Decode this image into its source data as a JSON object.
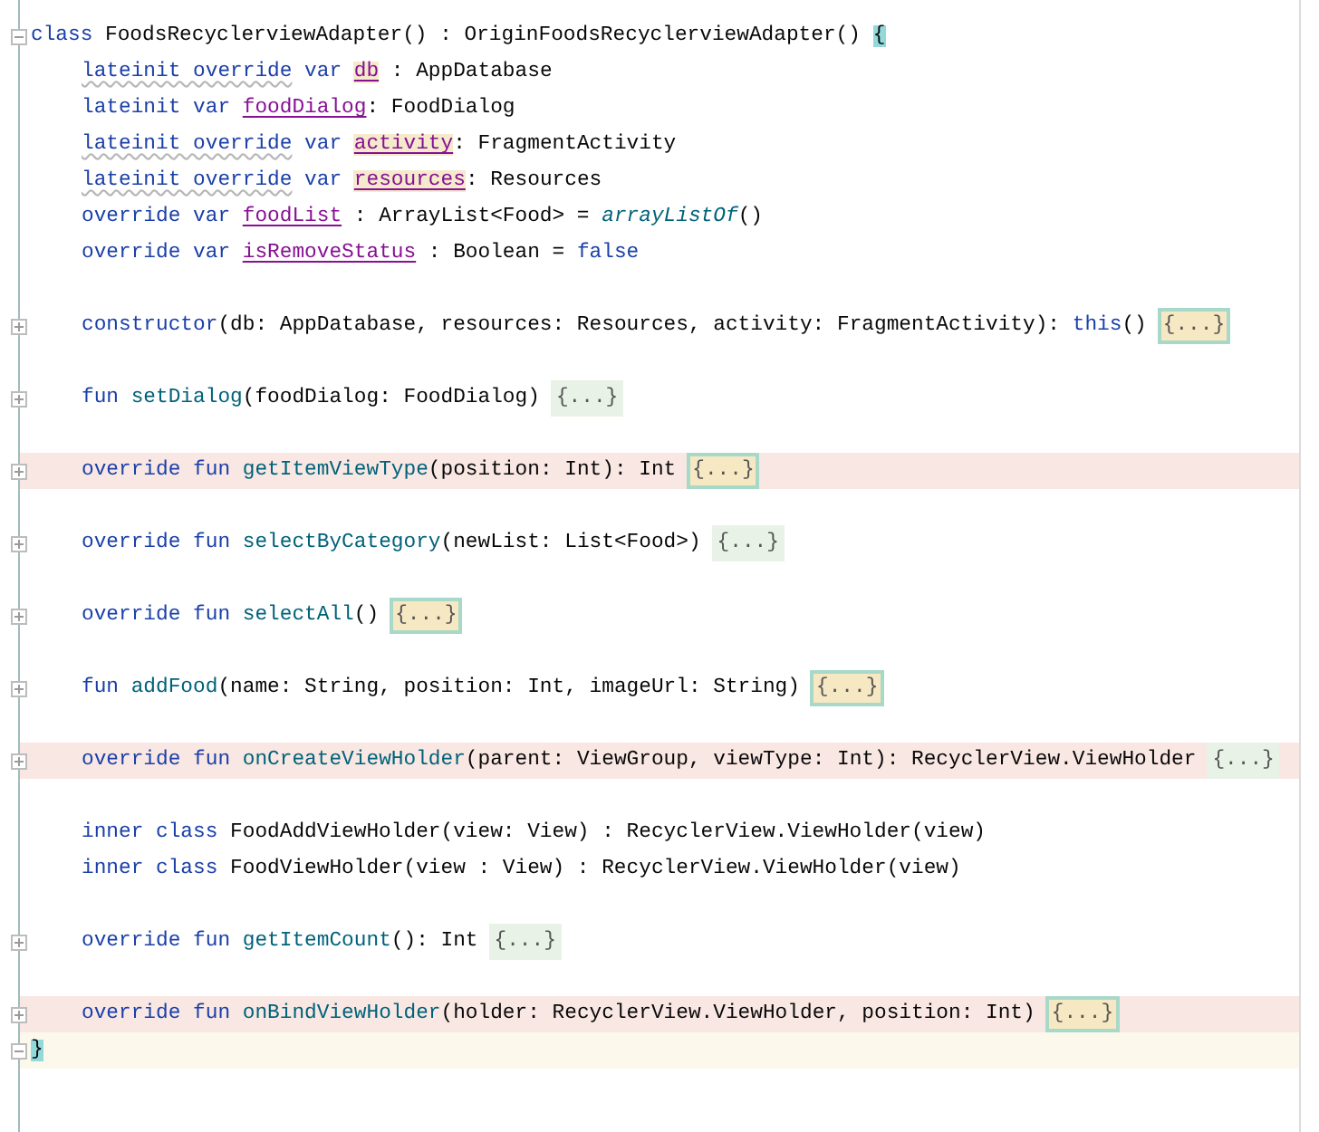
{
  "editor": {
    "class_header": {
      "collapsed": false,
      "tokens": [
        {
          "text": "class ",
          "kind": "keyword"
        },
        {
          "text": "FoodsRecyclerviewAdapter() : OriginFoodsRecyclerviewAdapter() ",
          "kind": "plain"
        },
        {
          "text": "{",
          "kind": "brace-match"
        }
      ]
    },
    "members": [
      {
        "kind": "code",
        "highlight": false,
        "tokens": [
          {
            "text": "lateinit override",
            "kind": "warn-keyword"
          },
          {
            "text": " var ",
            "kind": "keyword"
          },
          {
            "text": "db",
            "kind": "warn-property"
          },
          {
            "text": " : AppDatabase",
            "kind": "plain"
          }
        ]
      },
      {
        "kind": "code",
        "highlight": false,
        "tokens": [
          {
            "text": "lateinit var ",
            "kind": "keyword"
          },
          {
            "text": "foodDialog",
            "kind": "property"
          },
          {
            "text": ": FoodDialog",
            "kind": "plain"
          }
        ]
      },
      {
        "kind": "code",
        "highlight": false,
        "tokens": [
          {
            "text": "lateinit override",
            "kind": "warn-keyword"
          },
          {
            "text": " var ",
            "kind": "keyword"
          },
          {
            "text": "activity",
            "kind": "warn-property"
          },
          {
            "text": ": FragmentActivity",
            "kind": "plain"
          }
        ]
      },
      {
        "kind": "code",
        "highlight": false,
        "tokens": [
          {
            "text": "lateinit override",
            "kind": "warn-keyword"
          },
          {
            "text": " var ",
            "kind": "keyword"
          },
          {
            "text": "resources",
            "kind": "warn-property"
          },
          {
            "text": ": Resources",
            "kind": "plain"
          }
        ]
      },
      {
        "kind": "code",
        "highlight": false,
        "tokens": [
          {
            "text": "override var ",
            "kind": "keyword"
          },
          {
            "text": "foodList",
            "kind": "property"
          },
          {
            "text": " : ArrayList<Food> = ",
            "kind": "plain"
          },
          {
            "text": "arrayListOf",
            "kind": "call-italic"
          },
          {
            "text": "()",
            "kind": "plain"
          }
        ]
      },
      {
        "kind": "code",
        "highlight": false,
        "tokens": [
          {
            "text": "override var ",
            "kind": "keyword"
          },
          {
            "text": "isRemoveStatus",
            "kind": "property"
          },
          {
            "text": " : Boolean = ",
            "kind": "plain"
          },
          {
            "text": "false",
            "kind": "keyword"
          }
        ]
      },
      {
        "kind": "blank"
      },
      {
        "kind": "code",
        "highlight": false,
        "collapsed": true,
        "tokens": [
          {
            "text": "constructor",
            "kind": "keyword"
          },
          {
            "text": "(db: AppDatabase, resources: Resources, activity: FragmentActivity): ",
            "kind": "plain"
          },
          {
            "text": "this",
            "kind": "keyword"
          },
          {
            "text": "()",
            "kind": "plain"
          }
        ],
        "folded": {
          "text": "{...}",
          "boxed": true
        }
      },
      {
        "kind": "blank"
      },
      {
        "kind": "code",
        "highlight": false,
        "collapsed": true,
        "tokens": [
          {
            "text": "fun ",
            "kind": "keyword"
          },
          {
            "text": "setDialog",
            "kind": "function"
          },
          {
            "text": "(foodDialog: FoodDialog)",
            "kind": "plain"
          }
        ],
        "folded": {
          "text": "{...}",
          "boxed": false
        }
      },
      {
        "kind": "blank"
      },
      {
        "kind": "code",
        "highlight": true,
        "collapsed": true,
        "tokens": [
          {
            "text": "override fun ",
            "kind": "keyword"
          },
          {
            "text": "getItemViewType",
            "kind": "function"
          },
          {
            "text": "(position: Int): Int",
            "kind": "plain"
          }
        ],
        "folded": {
          "text": "{...}",
          "boxed": true
        }
      },
      {
        "kind": "blank"
      },
      {
        "kind": "code",
        "highlight": false,
        "collapsed": true,
        "tokens": [
          {
            "text": "override fun ",
            "kind": "keyword"
          },
          {
            "text": "selectByCategory",
            "kind": "function"
          },
          {
            "text": "(newList: List<Food>)",
            "kind": "plain"
          }
        ],
        "folded": {
          "text": "{...}",
          "boxed": false
        }
      },
      {
        "kind": "blank"
      },
      {
        "kind": "code",
        "highlight": false,
        "collapsed": true,
        "tokens": [
          {
            "text": "override fun ",
            "kind": "keyword"
          },
          {
            "text": "selectAll",
            "kind": "function"
          },
          {
            "text": "()",
            "kind": "plain"
          }
        ],
        "folded": {
          "text": "{...}",
          "boxed": true
        }
      },
      {
        "kind": "blank"
      },
      {
        "kind": "code",
        "highlight": false,
        "collapsed": true,
        "tokens": [
          {
            "text": "fun ",
            "kind": "keyword"
          },
          {
            "text": "addFood",
            "kind": "function"
          },
          {
            "text": "(name: String, position: Int, imageUrl: String)",
            "kind": "plain"
          }
        ],
        "folded": {
          "text": "{...}",
          "boxed": true
        }
      },
      {
        "kind": "blank"
      },
      {
        "kind": "code",
        "highlight": true,
        "collapsed": true,
        "tokens": [
          {
            "text": "override fun ",
            "kind": "keyword"
          },
          {
            "text": "onCreateViewHolder",
            "kind": "function"
          },
          {
            "text": "(parent: ViewGroup, viewType: Int): RecyclerView.ViewHolder",
            "kind": "plain"
          }
        ],
        "folded": {
          "text": "{...}",
          "boxed": false
        }
      },
      {
        "kind": "blank"
      },
      {
        "kind": "code",
        "highlight": false,
        "tokens": [
          {
            "text": "inner class ",
            "kind": "keyword"
          },
          {
            "text": "FoodAddViewHolder(view: View) : RecyclerView.ViewHolder(view)",
            "kind": "plain"
          }
        ]
      },
      {
        "kind": "code",
        "highlight": false,
        "tokens": [
          {
            "text": "inner class ",
            "kind": "keyword"
          },
          {
            "text": "FoodViewHolder(view : View) : RecyclerView.ViewHolder(view)",
            "kind": "plain"
          }
        ]
      },
      {
        "kind": "blank"
      },
      {
        "kind": "code",
        "highlight": false,
        "collapsed": true,
        "tokens": [
          {
            "text": "override fun ",
            "kind": "keyword"
          },
          {
            "text": "getItemCount",
            "kind": "function"
          },
          {
            "text": "(): Int",
            "kind": "plain"
          }
        ],
        "folded": {
          "text": "{...}",
          "boxed": false
        }
      },
      {
        "kind": "blank"
      },
      {
        "kind": "code",
        "highlight": true,
        "collapsed": true,
        "tokens": [
          {
            "text": "override fun ",
            "kind": "keyword"
          },
          {
            "text": "onBindViewHolder",
            "kind": "function"
          },
          {
            "text": "(holder: RecyclerView.ViewHolder, position: Int)",
            "kind": "plain"
          }
        ],
        "folded": {
          "text": "{...}",
          "boxed": true
        }
      }
    ],
    "closing": {
      "current": true,
      "collapsed": false,
      "tokens": [
        {
          "text": "}",
          "kind": "brace-match"
        }
      ]
    }
  }
}
